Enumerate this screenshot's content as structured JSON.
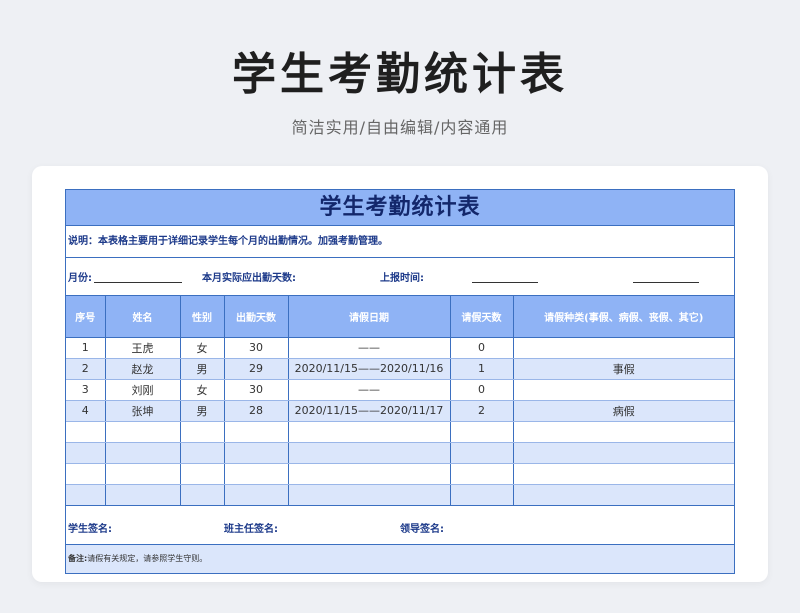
{
  "hero": {
    "title": "学生考勤统计表",
    "subtitle": "简洁实用/自由编辑/内容通用"
  },
  "sheet": {
    "title": "学生考勤统计表",
    "description": "说明：本表格主要用于详细记录学生每个月的出勤情况。加强考勤管理。",
    "info": {
      "month_label": "月份:",
      "days_label": "本月实际应出勤天数:",
      "report_label": "上报时间:"
    },
    "headers": [
      "序号",
      "姓名",
      "性别",
      "出勤天数",
      "请假日期",
      "请假天数",
      "请假种类(事假、病假、丧假、其它)"
    ],
    "rows": [
      [
        "1",
        "王虎",
        "女",
        "30",
        "——",
        "0",
        ""
      ],
      [
        "2",
        "赵龙",
        "男",
        "29",
        "2020/11/15——2020/11/16",
        "1",
        "事假"
      ],
      [
        "3",
        "刘刚",
        "女",
        "30",
        "——",
        "0",
        ""
      ],
      [
        "4",
        "张坤",
        "男",
        "28",
        "2020/11/15——2020/11/17",
        "2",
        "病假"
      ],
      [
        "",
        "",
        "",
        "",
        "",
        "",
        ""
      ],
      [
        "",
        "",
        "",
        "",
        "",
        "",
        ""
      ],
      [
        "",
        "",
        "",
        "",
        "",
        "",
        ""
      ],
      [
        "",
        "",
        "",
        "",
        "",
        "",
        ""
      ]
    ],
    "signatures": {
      "student": "学生签名:",
      "teacher": "班主任签名:",
      "leader": "领导签名:"
    },
    "note_label": "备注:",
    "note_text": "请假有关规定，请参照学生守则。"
  }
}
